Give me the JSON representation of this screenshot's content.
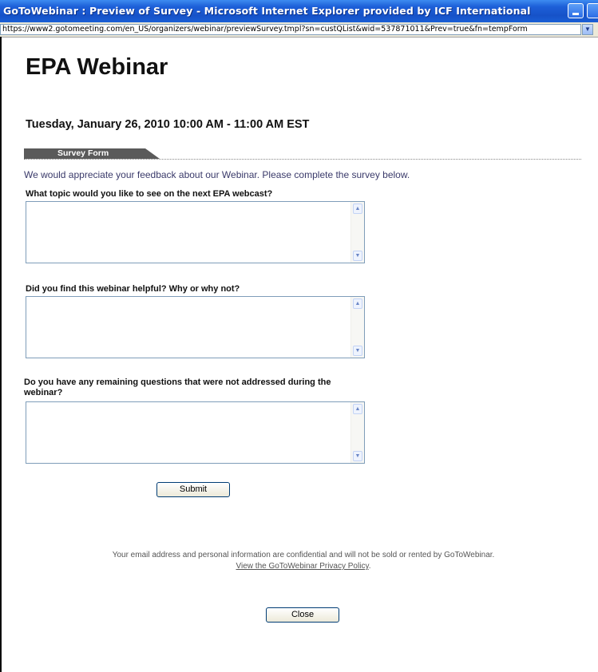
{
  "window": {
    "title": "GoToWebinar : Preview of Survey - Microsoft Internet Explorer provided by ICF International",
    "url": "https://www2.gotomeeting.com/en_US/organizers/webinar/previewSurvey.tmpl?sn=custQList&wid=537871011&Prev=true&fn=tempForm"
  },
  "page": {
    "title": "EPA Webinar",
    "date": "Tuesday, January 26, 2010 10:00 AM - 11:00 AM EST",
    "tab_label": "Survey Form",
    "intro": "We would appreciate your feedback about our Webinar. Please complete the survey below."
  },
  "questions": [
    {
      "label": "What topic would you like to see on the next EPA webcast?",
      "value": ""
    },
    {
      "label": "Did you find this webinar helpful? Why or why not?",
      "value": ""
    },
    {
      "label": "Do you have any remaining questions that were not addressed during the webinar?",
      "value": ""
    }
  ],
  "buttons": {
    "submit": "Submit",
    "close": "Close"
  },
  "footer": {
    "notice": "Your email address and personal information are confidential and will not be sold or rented by GoToWebinar.",
    "privacy_link": "View the GoToWebinar Privacy Policy"
  },
  "icons": [
    "minimize-icon",
    "maximize-icon",
    "address-dropdown-icon",
    "scroll-up-icon",
    "scroll-down-icon"
  ]
}
